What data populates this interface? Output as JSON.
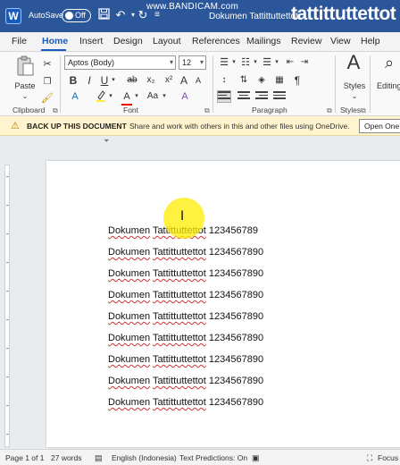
{
  "titlebar": {
    "app_icon": "W",
    "autosave_label": "AutoSave",
    "autosave_state": "Off",
    "recorder_watermark": "www.BANDICAM.com",
    "document_title": "Dokumen Tattittuttettot",
    "overlay_title": "tattittuttettot",
    "icons": [
      "save-icon",
      "undo-icon",
      "redo-icon",
      "customize-icon"
    ]
  },
  "tabs": [
    {
      "label": "File"
    },
    {
      "label": "Home",
      "active": true
    },
    {
      "label": "Insert"
    },
    {
      "label": "Design"
    },
    {
      "label": "Layout"
    },
    {
      "label": "References"
    },
    {
      "label": "Mailings"
    },
    {
      "label": "Review"
    },
    {
      "label": "View"
    },
    {
      "label": "Help"
    }
  ],
  "ribbon": {
    "clipboard": {
      "paste_label": "Paste",
      "group_label": "Clipboard"
    },
    "font": {
      "font_name": "Aptos (Body)",
      "font_size": "12",
      "bold": "B",
      "italic": "I",
      "underline": "U",
      "strikethrough": "ab",
      "subscript": "x₂",
      "superscript": "x²",
      "grow": "A",
      "shrink": "A",
      "change_case": "Aa",
      "clear_format": "A",
      "group_label": "Font"
    },
    "paragraph": {
      "pilcrow": "¶",
      "group_label": "Paragraph"
    },
    "styles": {
      "label": "Styles",
      "group_label": "Styles"
    },
    "editing": {
      "label": "Editing"
    }
  },
  "message_bar": {
    "title": "BACK UP THIS DOCUMENT",
    "text": "Share and work with others in this and other files using OneDrive.",
    "button": "Open One"
  },
  "document": {
    "lines": [
      {
        "words": [
          "Dokumen",
          "Tattittuttettot"
        ],
        "number": "123456789"
      },
      {
        "words": [
          "Dokumen",
          "Tattittuttettot"
        ],
        "number": "1234567890"
      },
      {
        "words": [
          "Dokumen",
          "Tattittuttettot"
        ],
        "number": "1234567890"
      },
      {
        "words": [
          "Dokumen",
          "Tattittuttettot"
        ],
        "number": "1234567890"
      },
      {
        "words": [
          "Dokumen",
          "Tattittuttettot"
        ],
        "number": "1234567890"
      },
      {
        "words": [
          "Dokumen",
          "Tattittuttettot"
        ],
        "number": "1234567890"
      },
      {
        "words": [
          "Dokumen",
          "Tattittuttettot"
        ],
        "number": "1234567890"
      },
      {
        "words": [
          "Dokumen",
          "Tattittuttettot"
        ],
        "number": "1234567890"
      },
      {
        "words": [
          "Dokumen",
          "Tattittuttettot"
        ],
        "number": "1234567890"
      }
    ],
    "cursor": "I"
  },
  "statusbar": {
    "page": "Page 1 of 1",
    "words": "27 words",
    "language": "English (Indonesia)",
    "text_predictions": "Text Predictions: On",
    "focus": "Focus"
  },
  "colors": {
    "titlebar": "#2b579a",
    "accent": "#185abd",
    "message_bar": "#fff4ce",
    "spell_underline": "#d13438",
    "cursor_highlight": "#ffec00"
  }
}
